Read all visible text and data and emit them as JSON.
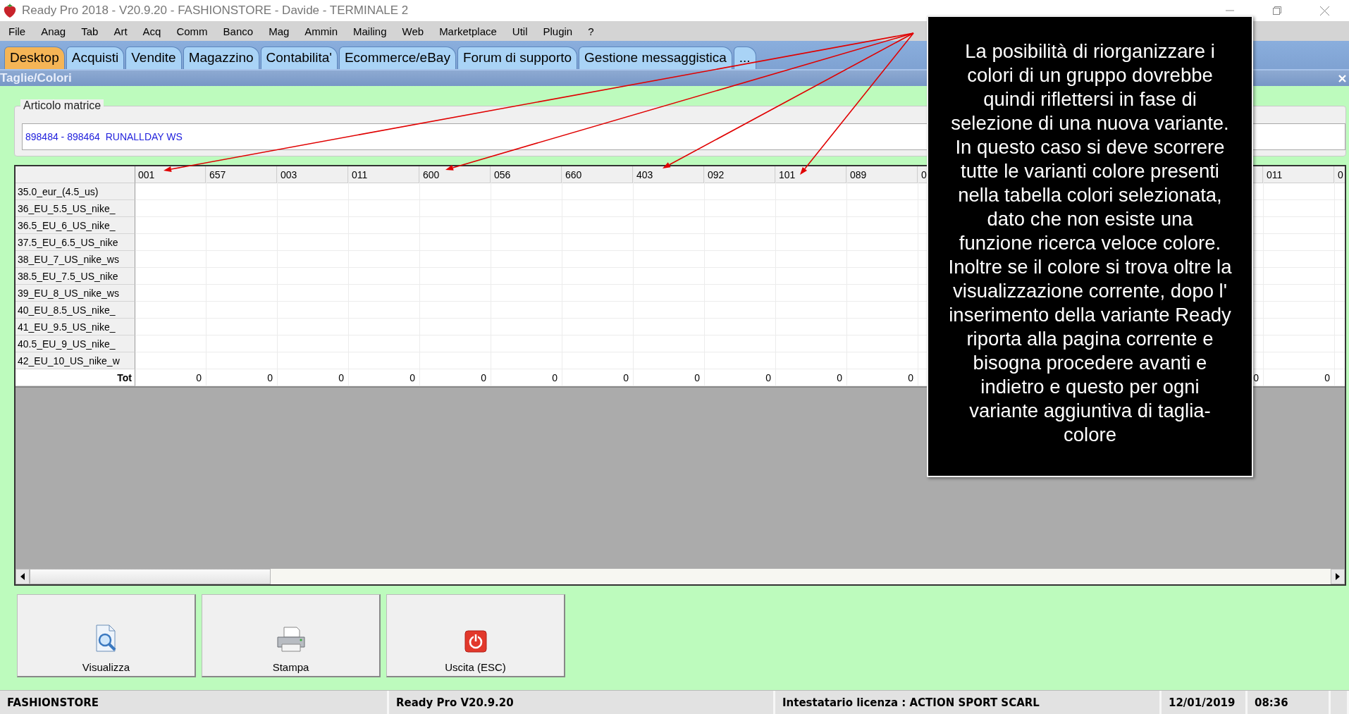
{
  "window": {
    "title": "Ready Pro 2018 - V20.9.20 - FASHIONSTORE - Davide - TERMINALE 2"
  },
  "menu": [
    "File",
    "Anag",
    "Tab",
    "Art",
    "Acq",
    "Comm",
    "Banco",
    "Mag",
    "Ammin",
    "Mailing",
    "Web",
    "Marketplace",
    "Util",
    "Plugin",
    "?"
  ],
  "tabs": [
    {
      "label": "Desktop",
      "selected": true
    },
    {
      "label": "Acquisti",
      "selected": false
    },
    {
      "label": "Vendite",
      "selected": false
    },
    {
      "label": "Magazzino",
      "selected": false
    },
    {
      "label": "Contabilita'",
      "selected": false
    },
    {
      "label": "Ecommerce/eBay",
      "selected": false
    },
    {
      "label": "Forum di supporto",
      "selected": false
    },
    {
      "label": "Gestione messaggistica",
      "selected": false
    },
    {
      "label": "...",
      "selected": false
    }
  ],
  "panel": {
    "title": "Taglie/Colori"
  },
  "article": {
    "legend": "Articolo matrice",
    "value": "898484 - 898464  RUNALLDAY WS"
  },
  "grid": {
    "rows": [
      "35.0_eur_(4.5_us)",
      "36_EU_5.5_US_nike_",
      "36.5_EU_6_US_nike_",
      "37.5_EU_6.5_US_nike",
      "38_EU_7_US_nike_ws",
      "38.5_EU_7.5_US_nike",
      "39_EU_8_US_nike_ws",
      "40_EU_8.5_US_nike_",
      "41_EU_9.5_US_nike_",
      "40.5_EU_9_US_nike_",
      "42_EU_10_US_nike_w"
    ],
    "total_label": "Tot",
    "columns_left": [
      {
        "label": "001",
        "total": "0"
      },
      {
        "label": "657",
        "total": "0"
      },
      {
        "label": "003",
        "total": "0"
      },
      {
        "label": "011",
        "total": "0"
      },
      {
        "label": "600",
        "total": "0"
      },
      {
        "label": "056",
        "total": "0"
      },
      {
        "label": "660",
        "total": "0"
      },
      {
        "label": "403",
        "total": "0"
      },
      {
        "label": "092",
        "total": "0"
      },
      {
        "label": "101",
        "total": "0"
      },
      {
        "label": "089",
        "total": "0"
      },
      {
        "label": "0"
      }
    ],
    "columns_right": [
      {
        "total": "0"
      },
      {
        "label": "011",
        "total": "0"
      },
      {
        "label": "0"
      }
    ]
  },
  "buttons": [
    {
      "label": "Visualizza",
      "kind": "preview"
    },
    {
      "label": "Stampa",
      "kind": "print"
    },
    {
      "label": "Uscita (ESC)",
      "kind": "exit"
    }
  ],
  "status_bar": [
    "FASHIONSTORE",
    "Ready Pro V20.9.20",
    "Intestatario licenza : ACTION SPORT SCARL",
    "12/01/2019",
    "08:36"
  ],
  "callout": {
    "text": "La posibilità di riorganizzare i\ncolori di un gruppo dovrebbe\nquindi riflettersi in fase di\nselezione di una nuova variante.\nIn questo caso si deve scorrere\ntutte le varianti colore presenti\nnella tabella colori selezionata,\ndato che non esiste una\nfunzione ricerca veloce colore.\nInoltre se il colore si trova oltre la\nvisualizzazione corrente, dopo l'\ninserimento della variante Ready\nriporta alla pagina corrente e\nbisogna procedere avanti e\nindietro e questo per ogni\nvariante aggiuntiva di taglia-\ncolore"
  }
}
